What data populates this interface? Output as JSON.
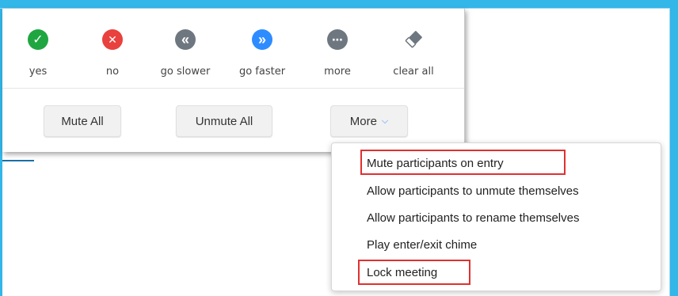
{
  "reactions": [
    {
      "label": "yes",
      "icon": "check-icon",
      "color": "#1fa640",
      "glyph": "✓"
    },
    {
      "label": "no",
      "icon": "x-icon",
      "color": "#e8413e",
      "glyph": "✕"
    },
    {
      "label": "go slower",
      "icon": "rewind-icon",
      "color": "#6e7780",
      "glyph": "«"
    },
    {
      "label": "go faster",
      "icon": "fast-forward-icon",
      "color": "#2d8cff",
      "glyph": "»"
    },
    {
      "label": "more",
      "icon": "ellipsis-icon",
      "color": "#6e7780",
      "glyph": "⋯"
    },
    {
      "label": "clear all",
      "icon": "eraser-icon",
      "color": "#6e7780",
      "glyph": ""
    }
  ],
  "buttons": {
    "mute_all": "Mute All",
    "unmute_all": "Unmute All",
    "more": "More"
  },
  "menu": {
    "items": [
      "Mute participants on entry",
      "Allow participants to unmute themselves",
      "Allow participants to rename themselves",
      "Play enter/exit chime",
      "Lock meeting"
    ],
    "highlighted": [
      "Mute participants on entry",
      "Lock meeting"
    ]
  },
  "colors": {
    "frame": "#33b6e8",
    "accent": "#2d8cff",
    "highlight": "#e03030"
  }
}
